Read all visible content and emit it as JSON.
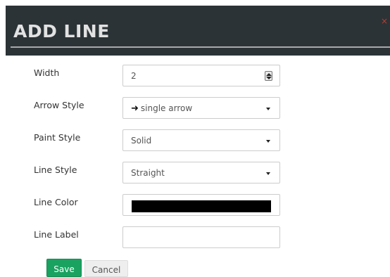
{
  "dialog": {
    "title": "ADD LINE",
    "close_glyph": "×"
  },
  "form": {
    "width": {
      "label": "Width",
      "value": "2"
    },
    "arrow_style": {
      "label": "Arrow Style",
      "icon": "right-arrow-icon",
      "glyph": "➜",
      "value": "single arrow"
    },
    "paint_style": {
      "label": "Paint Style",
      "value": "Solid"
    },
    "line_style": {
      "label": "Line Style",
      "value": "Straight"
    },
    "line_color": {
      "label": "Line Color",
      "value": "#000000"
    },
    "line_label": {
      "label": "Line Label",
      "value": ""
    }
  },
  "buttons": {
    "save": "Save",
    "cancel": "Cancel"
  },
  "colors": {
    "header_bg": "#2b3337",
    "title_text": "#e2e2e2",
    "close": "#c0392b",
    "save_bg": "#1aa260"
  }
}
